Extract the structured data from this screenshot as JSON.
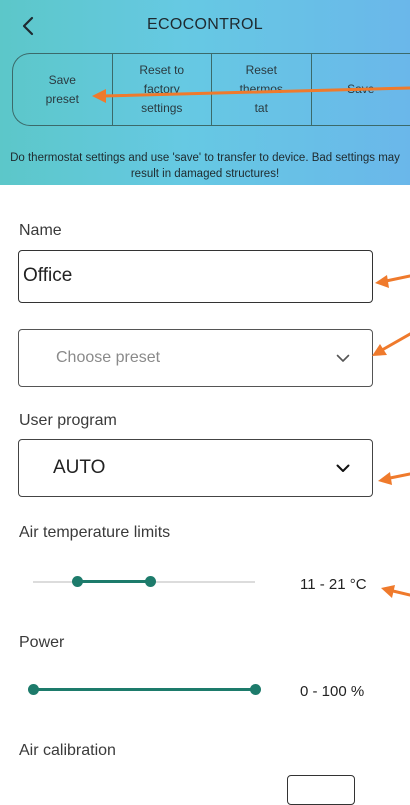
{
  "app": {
    "title": "ECOCONTROL"
  },
  "toolbar": {
    "buttons": [
      {
        "label": "Save\npreset"
      },
      {
        "label": "Reset to\nfactory\nsettings"
      },
      {
        "label": "Reset\nthermos\ntat"
      },
      {
        "label": "Save"
      }
    ]
  },
  "warning": "Do thermostat settings and use 'save' to transfer to device. Bad settings may result in damaged structures!",
  "name": {
    "label": "Name",
    "value": "Office"
  },
  "preset": {
    "placeholder": "Choose preset"
  },
  "user_program": {
    "label": "User program",
    "value": "AUTO"
  },
  "air_temperature_limits": {
    "label": "Air temperature limits",
    "value_text": "11 - 21 °C",
    "min_frac": 0.2,
    "max_frac": 0.53
  },
  "power": {
    "label": "Power",
    "value_text": "0 - 100 %",
    "min_frac": 0.0,
    "max_frac": 1.0
  },
  "air_calibration": {
    "label": "Air calibration"
  },
  "colors": {
    "accent": "#1d7b6b",
    "header_gradient_start": "#5cc7c9",
    "header_gradient_end": "#6ab7ea",
    "annotation_arrow": "#ef7a2c"
  },
  "icons": {
    "back": "chevron-left-icon",
    "dropdown": "chevron-down-icon"
  }
}
